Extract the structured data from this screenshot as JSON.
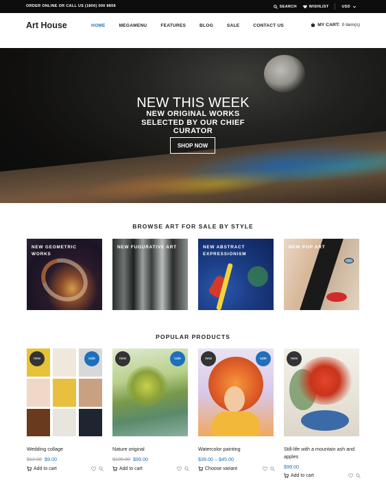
{
  "topbar": {
    "order_text": "ORDER ONLINE OR CALL US (1800) 000 8808",
    "search_label": "SEARCH",
    "wishlist_label": "WISHLIST",
    "currency": "USD"
  },
  "header": {
    "logo": "Art House",
    "nav": [
      "HOME",
      "MEGAMENU",
      "FEATURES",
      "BLOG",
      "SALE",
      "CONTACT US"
    ],
    "cart_label": "MY CART:",
    "cart_count": "0 item(s)"
  },
  "hero": {
    "title": "NEW THIS WEEK",
    "subtitle": "NEW ORIGINAL WORKS SELECTED BY OUR CHIEF CURATOR",
    "button": "SHOP NOW"
  },
  "browse": {
    "title": "BROWSE ART FOR SALE BY STYLE",
    "styles": [
      "NEW GEOMETRIC WORKS",
      "NEW FUGURATIVE ART",
      "NEW ABSTRACT EXPRESSIONISM",
      "NEW POP ART"
    ]
  },
  "popular": {
    "title": "POPULAR PRODUCTS",
    "badges": {
      "new": "new",
      "sale": "sale"
    },
    "products": [
      {
        "name": "Wedding collage",
        "old_price": "$12.00",
        "price": "$9.00",
        "action": "Add to cart"
      },
      {
        "name": "Nature original",
        "old_price": "$105.00",
        "price": "$99.00",
        "action": "Add to cart"
      },
      {
        "name": "Watercolor painting",
        "old_price": "",
        "price": "$39.00 – $45.00",
        "action": "Choose variant"
      },
      {
        "name": "Still-life with a mountain ash and apples",
        "old_price": "",
        "price": "$99.00",
        "action": "Add to cart"
      }
    ]
  },
  "colors": {
    "accent": "#1f6fbd",
    "topbar": "#0d0d0d"
  }
}
